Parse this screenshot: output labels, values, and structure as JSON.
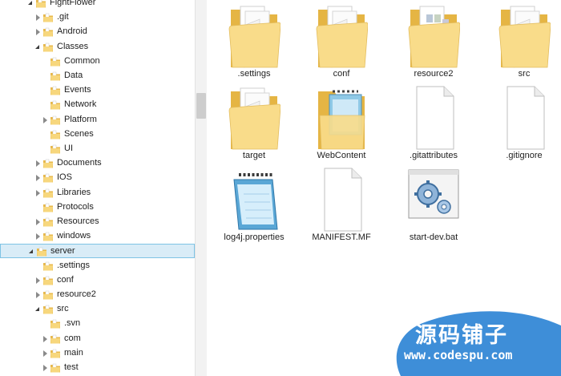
{
  "tree": {
    "items": [
      {
        "label": "FightFlower",
        "state": "expanded"
      },
      {
        "label": ".git",
        "state": "collapsed"
      },
      {
        "label": "Android",
        "state": "collapsed"
      },
      {
        "label": "Classes",
        "state": "expanded"
      },
      {
        "label": "Common",
        "state": "none"
      },
      {
        "label": "Data",
        "state": "none"
      },
      {
        "label": "Events",
        "state": "none"
      },
      {
        "label": "Network",
        "state": "none"
      },
      {
        "label": "Platform",
        "state": "collapsed"
      },
      {
        "label": "Scenes",
        "state": "none"
      },
      {
        "label": "UI",
        "state": "none"
      },
      {
        "label": "Documents",
        "state": "collapsed"
      },
      {
        "label": "IOS",
        "state": "collapsed"
      },
      {
        "label": "Libraries",
        "state": "collapsed"
      },
      {
        "label": "Protocols",
        "state": "none"
      },
      {
        "label": "Resources",
        "state": "collapsed"
      },
      {
        "label": "windows",
        "state": "collapsed"
      },
      {
        "label": "server",
        "state": "expanded",
        "selected": true
      },
      {
        "label": ".settings",
        "state": "none"
      },
      {
        "label": "conf",
        "state": "collapsed"
      },
      {
        "label": "resource2",
        "state": "collapsed"
      },
      {
        "label": "src",
        "state": "expanded"
      },
      {
        "label": ".svn",
        "state": "none"
      },
      {
        "label": "com",
        "state": "collapsed"
      },
      {
        "label": "main",
        "state": "collapsed"
      },
      {
        "label": "test",
        "state": "collapsed"
      }
    ]
  },
  "content": {
    "items": [
      {
        "label": ".settings",
        "icon": "folder-documents-icon"
      },
      {
        "label": "conf",
        "icon": "folder-documents-icon"
      },
      {
        "label": "resource2",
        "icon": "folder-images-icon"
      },
      {
        "label": "src",
        "icon": "folder-documents-icon"
      },
      {
        "label": "target",
        "icon": "folder-documents-icon"
      },
      {
        "label": "WebContent",
        "icon": "folder-notepad-icon"
      },
      {
        "label": ".gitattributes",
        "icon": "blank-file-icon"
      },
      {
        "label": ".gitignore",
        "icon": "blank-file-icon"
      },
      {
        "label": "log4j.properties",
        "icon": "notepad-file-icon"
      },
      {
        "label": "MANIFEST.MF",
        "icon": "blank-file-icon"
      },
      {
        "label": "start-dev.bat",
        "icon": "batch-file-icon"
      }
    ]
  },
  "watermark": {
    "title": "源码铺子",
    "url": "www.codespu.com"
  },
  "colors": {
    "selection_bg": "#d9ecf7",
    "selection_border": "#7ec3e5",
    "folder": "#f5d57a",
    "watermark": "#3e8ed8"
  }
}
